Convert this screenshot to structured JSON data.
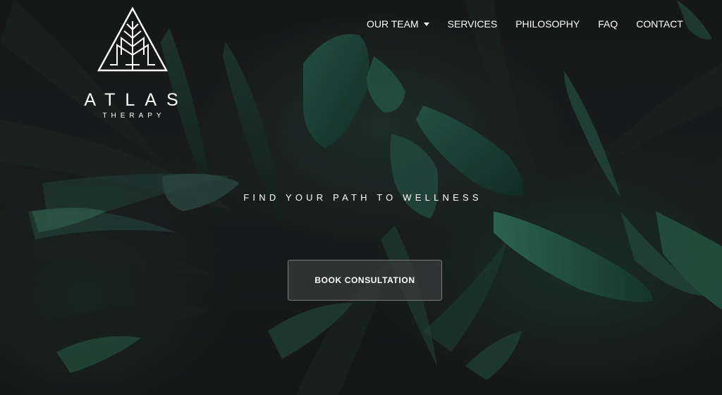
{
  "brand": {
    "name": "ATLAS",
    "subtitle": "THERAPY",
    "logo_icon": "tree-triangle-icon"
  },
  "nav": {
    "items": [
      {
        "label": "OUR TEAM",
        "has_dropdown": true
      },
      {
        "label": "SERVICES"
      },
      {
        "label": "PHILOSOPHY"
      },
      {
        "label": "FAQ"
      },
      {
        "label": "CONTACT"
      }
    ]
  },
  "hero": {
    "tagline": "FIND YOUR PATH TO WELLNESS",
    "cta_label": "BOOK CONSULTATION",
    "background": "dark green leaves photo"
  },
  "colors": {
    "text": "#ffffff",
    "leaf_green": "#1f6b52",
    "background": "#1c1f1e"
  }
}
